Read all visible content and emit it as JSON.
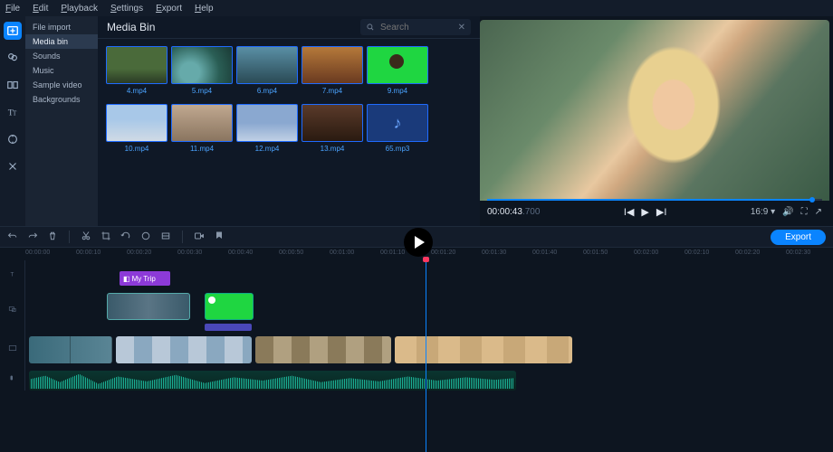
{
  "menubar": [
    "File",
    "Edit",
    "Playback",
    "Settings",
    "Export",
    "Help"
  ],
  "tools": [
    {
      "name": "import-icon",
      "active": true
    },
    {
      "name": "filters-icon"
    },
    {
      "name": "transitions-icon"
    },
    {
      "name": "titles-icon"
    },
    {
      "name": "keyframes-icon"
    },
    {
      "name": "more-tools-icon"
    }
  ],
  "filelist": {
    "items": [
      "File import",
      "Media bin",
      "Sounds",
      "Music",
      "Sample video",
      "Backgrounds"
    ],
    "selected": 1
  },
  "mediapanel": {
    "title": "Media Bin",
    "search_placeholder": "Search",
    "clips": [
      {
        "label": "4.mp4",
        "cls": "th-4"
      },
      {
        "label": "5.mp4",
        "cls": "th-5"
      },
      {
        "label": "6.mp4",
        "cls": "th-6"
      },
      {
        "label": "7.mp4",
        "cls": "th-7"
      },
      {
        "label": "9.mp4",
        "cls": "th-9"
      },
      {
        "label": "10.mp4",
        "cls": "th-10"
      },
      {
        "label": "11.mp4",
        "cls": "th-11"
      },
      {
        "label": "12.mp4",
        "cls": "th-12"
      },
      {
        "label": "13.mp4",
        "cls": "th-13"
      },
      {
        "label": "65.mp3",
        "cls": "th-65",
        "audio": true
      }
    ]
  },
  "preview": {
    "timecode": "00:00:43",
    "timecode_ms": ".700",
    "ratio": "16:9"
  },
  "midbar": {
    "export_label": "Export"
  },
  "ruler": [
    "00:00:00",
    "00:00:10",
    "00:00:20",
    "00:00:30",
    "00:00:40",
    "00:00:50",
    "00:01:00",
    "00:01:10",
    "00:01:20",
    "00:01:30",
    "00:01:40",
    "00:01:50",
    "00:02:00",
    "00:02:10",
    "00:02:20",
    "00:02:30"
  ],
  "timeline": {
    "title_clip": "My Trip"
  }
}
